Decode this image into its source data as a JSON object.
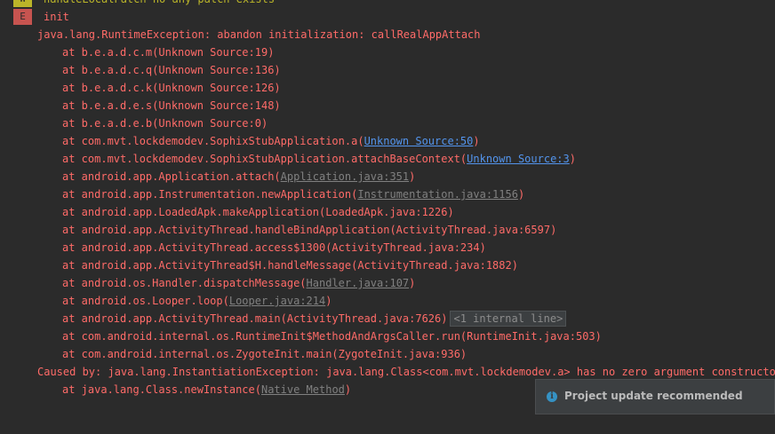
{
  "log": {
    "badges": {
      "warning": "W",
      "error": "E"
    },
    "warning_message": "handleLocalPatch no any patch exists",
    "error_tag": "init",
    "exception": "java.lang.RuntimeException: abandon initialization: callRealAppAttach",
    "frames": [
      {
        "at": "at b.e.a.d.c.m(Unknown Source:19)"
      },
      {
        "at": "at b.e.a.d.c.q(Unknown Source:136)"
      },
      {
        "at": "at b.e.a.d.c.k(Unknown Source:126)"
      },
      {
        "at": "at b.e.a.d.e.s(Unknown Source:148)"
      },
      {
        "at": "at b.e.a.d.e.b(Unknown Source:0)"
      },
      {
        "at": "at com.mvt.lockdemodev.SophixStubApplication.a(",
        "link": "Unknown Source:50",
        "tail": ")"
      },
      {
        "at": "at com.mvt.lockdemodev.SophixStubApplication.attachBaseContext(",
        "link": "Unknown Source:3",
        "tail": ")"
      },
      {
        "at": "at android.app.Application.attach(",
        "link": "Application.java:351",
        "tail": ")"
      },
      {
        "at": "at android.app.Instrumentation.newApplication(",
        "link": "Instrumentation.java:1156",
        "tail": ")"
      },
      {
        "at": "at android.app.LoadedApk.makeApplication(LoadedApk.java:1226)"
      },
      {
        "at": "at android.app.ActivityThread.handleBindApplication(ActivityThread.java:6597)"
      },
      {
        "at": "at android.app.ActivityThread.access$1300(ActivityThread.java:234)"
      },
      {
        "at": "at android.app.ActivityThread$H.handleMessage(ActivityThread.java:1882)"
      },
      {
        "at": "at android.os.Handler.dispatchMessage(",
        "link": "Handler.java:107",
        "tail": ")"
      },
      {
        "at": "at android.os.Looper.loop(",
        "link": "Looper.java:214",
        "tail": ")"
      },
      {
        "at": "at android.app.ActivityThread.main(ActivityThread.java:7626)",
        "fold": "<1 internal line>"
      },
      {
        "at": "at com.android.internal.os.RuntimeInit$MethodAndArgsCaller.run(RuntimeInit.java:503)"
      },
      {
        "at": "at com.android.internal.os.ZygoteInit.main(ZygoteInit.java:936)"
      }
    ],
    "caused_by": "Caused by: java.lang.InstantiationException: java.lang.Class<com.mvt.lockdemodev.a> has no zero argument constructor",
    "caused_frame": {
      "at": "at java.lang.Class.newInstance(",
      "link": "Native Method",
      "tail": ")"
    }
  },
  "colors": {
    "background": "#2b2b2b",
    "error_text": "#ff6b68",
    "warning_text": "#bbb529",
    "source_link": "#5394ec",
    "library_link": "#808080"
  },
  "notification": {
    "icon": "info-icon",
    "title": "Project update recommended"
  }
}
